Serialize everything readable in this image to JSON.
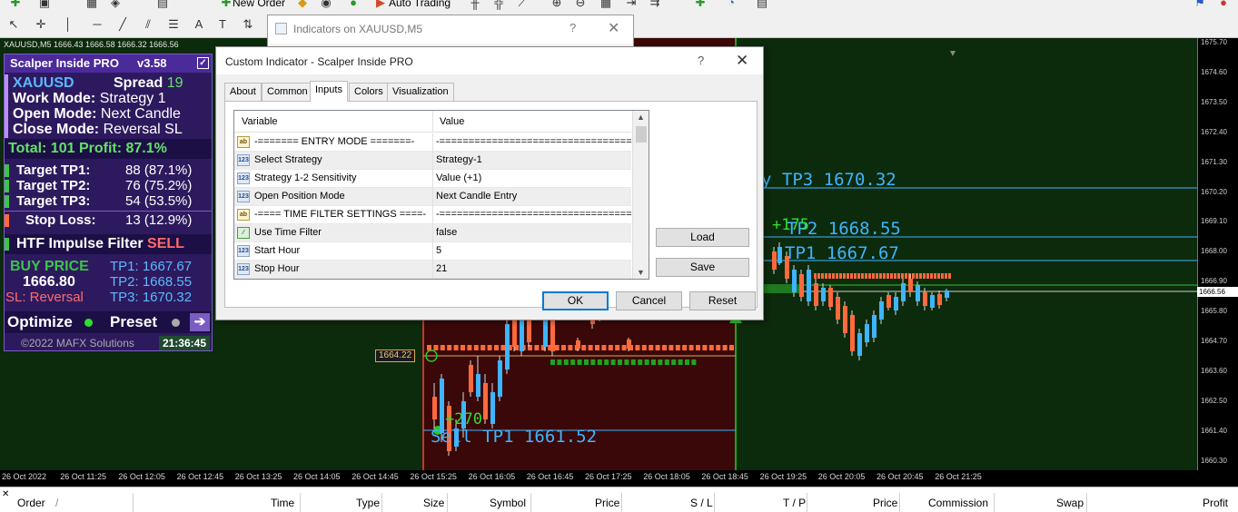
{
  "toolbar": {
    "new_order_label": "New Order",
    "auto_trading_label": "Auto Trading"
  },
  "chart": {
    "symbol_header": "XAUUSD,M5  1666.43 1666.58 1666.32 1666.56",
    "price_ticks": [
      "1675.70",
      "1674.60",
      "1673.50",
      "1672.40",
      "1671.30",
      "1670.20",
      "1669.10",
      "1668.00",
      "1666.90",
      "1665.80",
      "1664.70",
      "1663.60",
      "1662.50",
      "1661.40",
      "1660.30"
    ],
    "current_price": "1666.56",
    "time_ticks": [
      "26 Oct 2022",
      "26 Oct 11:25",
      "26 Oct 12:05",
      "26 Oct 12:45",
      "26 Oct 13:25",
      "26 Oct 14:05",
      "26 Oct 14:45",
      "26 Oct 15:25",
      "26 Oct 16:05",
      "26 Oct 16:45",
      "26 Oct 17:25",
      "26 Oct 18:05",
      "26 Oct 18:45",
      "26 Oct 19:25",
      "26 Oct 20:05",
      "26 Oct 20:45",
      "26 Oct 21:25"
    ],
    "entry_price_tag": "1664.22",
    "labels": {
      "tp3": "y TP3 1670.32",
      "tp2": "TP2 1668.55",
      "tp1": "TP1 1667.67",
      "plus_175": "+175",
      "plus_270": "+270",
      "sell_tp1": "Sell TP1 1661.52"
    },
    "colors": {
      "background": "#0c2a0c",
      "bull": "#3fb4ff",
      "bear": "#ff6a3d",
      "signal_green": "#22cc22"
    }
  },
  "indicator_panel": {
    "title": "Scalper Inside PRO",
    "version": "v3.58",
    "symbol": "XAUUSD",
    "spread_label": "Spread",
    "spread_value": "19",
    "work_mode_label": "Work Mode:",
    "work_mode_value": "Strategy 1",
    "open_mode_label": "Open Mode:",
    "open_mode_value": "Next Candle",
    "close_mode_label": "Close Mode:",
    "close_mode_value": "Reversal SL",
    "total": "Total: 101  Profit: 87.1%",
    "targets": [
      {
        "label": "Target TP1:",
        "value": "88 (87.1%)"
      },
      {
        "label": "Target TP2:",
        "value": "76 (75.2%)"
      },
      {
        "label": "Target TP3:",
        "value": "54 (53.5%)"
      }
    ],
    "stop_loss_label": "Stop Loss:",
    "stop_loss_value": "13 (12.9%)",
    "htf_label": "HTF Impulse Filter",
    "htf_value": "SELL",
    "buy_price_label": "BUY PRICE",
    "buy_price_value": "1666.80",
    "sl_text": "SL: Reversal",
    "tp1_text": "TP1: 1667.67",
    "tp2_text": "TP2: 1668.55",
    "tp3_text": "TP3: 1670.32",
    "optimize_label": "Optimize",
    "preset_label": "Preset",
    "copyright": "©2022 MAFX Solutions",
    "clock": "21:36:45"
  },
  "back_dialog": {
    "title": "Indicators on XAUUSD,M5",
    "help": "?",
    "close": "✕"
  },
  "dialog": {
    "title": "Custom Indicator - Scalper Inside PRO",
    "help": "?",
    "close": "✕",
    "tabs": [
      "About",
      "Common",
      "Inputs",
      "Colors",
      "Visualization"
    ],
    "active_tab": "Inputs",
    "grid_headers": {
      "variable": "Variable",
      "value": "Value"
    },
    "rows": [
      {
        "icon": "ab",
        "name": "-=======  ENTRY  MODE  =======-",
        "value": "-==================================-"
      },
      {
        "icon": "123",
        "name": "Select Strategy",
        "value": "Strategy-1"
      },
      {
        "icon": "123",
        "name": "Strategy 1-2 Sensitivity",
        "value": "Value (+1)"
      },
      {
        "icon": "123",
        "name": "Open Position Mode",
        "value": "Next Candle Entry"
      },
      {
        "icon": "ab",
        "name": "-==== TIME FILTER SETTINGS ====-",
        "value": "-==================================-"
      },
      {
        "icon": "bool",
        "name": "Use Time Filter",
        "value": "false"
      },
      {
        "icon": "123",
        "name": "Start Hour",
        "value": "5"
      },
      {
        "icon": "123",
        "name": "Stop Hour",
        "value": "21"
      }
    ],
    "load_label": "Load",
    "save_label": "Save",
    "ok_label": "OK",
    "cancel_label": "Cancel",
    "reset_label": "Reset"
  },
  "orders": {
    "close_glyph": "✕",
    "columns": [
      "Order",
      "Time",
      "Type",
      "Size",
      "Symbol",
      "Price",
      "S / L",
      "T / P",
      "Price",
      "Commission",
      "Swap",
      "Profit"
    ],
    "sort_glyph": "/"
  }
}
